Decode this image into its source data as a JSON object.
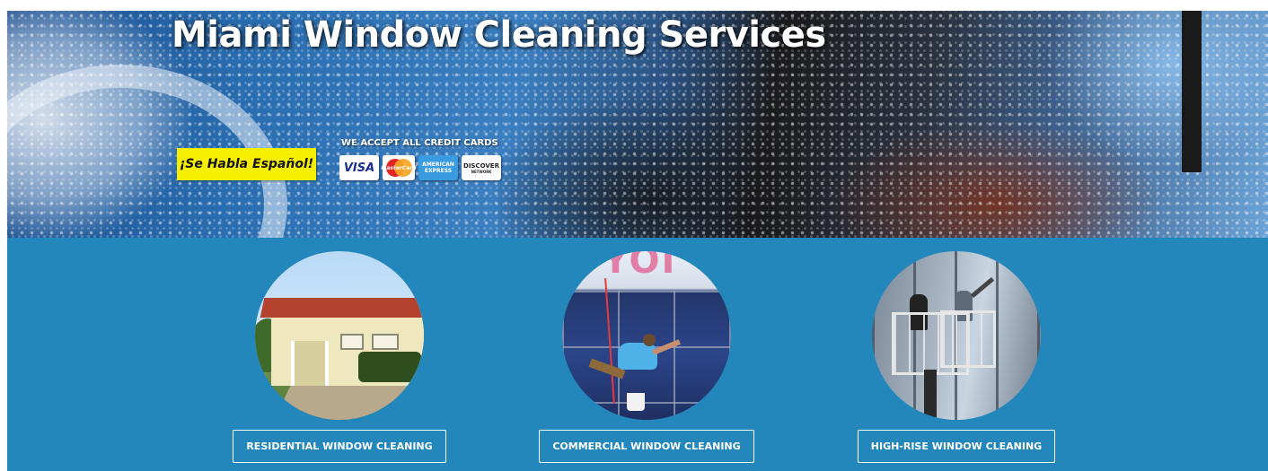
{
  "hero": {
    "title": "Miami Window Cleaning Services",
    "spanish_badge": "¡Se Habla Español!",
    "credit_cards_label": "WE ACCEPT ALL CREDIT CARDS",
    "cards": {
      "visa": "VISA",
      "mastercard": "MasterCard",
      "amex_line1": "AMERICAN",
      "amex_line2": "EXPRESS",
      "discover": "DISCOVER",
      "discover_sub": "NETWORK"
    }
  },
  "services": [
    {
      "label": "RESIDENTIAL WINDOW CLEANING",
      "image": "house-photo"
    },
    {
      "label": "COMMERCIAL WINDOW CLEANING",
      "image": "commercial-building-photo"
    },
    {
      "label": "HIGH-RISE WINDOW CLEANING",
      "image": "high-rise-photo"
    }
  ],
  "commercial_sign_text": "YOI",
  "colors": {
    "services_bg": "#2487bb",
    "badge_yellow": "#f7ef00",
    "button_border": "#ffffff"
  }
}
